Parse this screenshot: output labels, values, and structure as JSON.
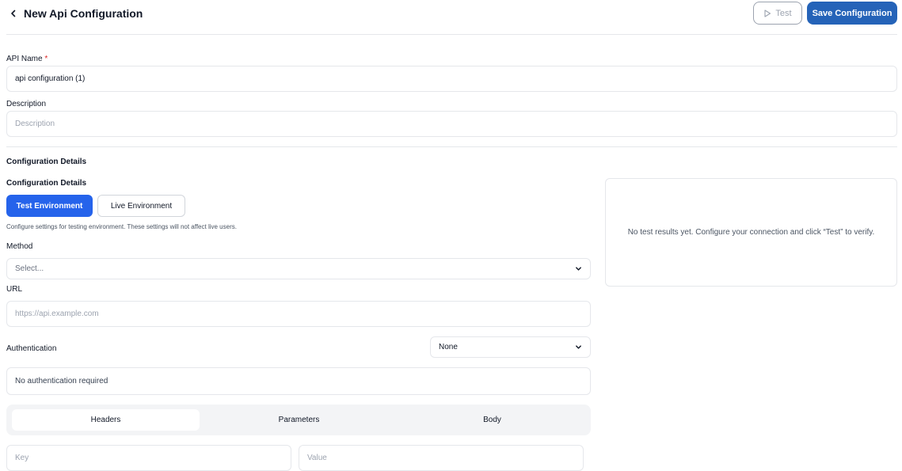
{
  "header": {
    "title": "New Api Configuration",
    "test_label": "Test",
    "save_label": "Save Configuration"
  },
  "form": {
    "api_name": {
      "label": "API Name",
      "required_mark": "*",
      "value": "api configuration (1)"
    },
    "description": {
      "label": "Description",
      "placeholder": "Description",
      "value": ""
    }
  },
  "config": {
    "section_title": "Configuration Details",
    "subsection_title": "Configuration Details",
    "env_tabs": [
      {
        "label": "Test Environment",
        "active": true
      },
      {
        "label": "Live Environment",
        "active": false
      }
    ],
    "hint": "Configure settings for testing environment. These settings will not affect live users.",
    "method": {
      "label": "Method",
      "placeholder": "Select..."
    },
    "url": {
      "label": "URL",
      "placeholder": "https://api.example.com"
    },
    "authentication": {
      "label": "Authentication",
      "selected": "None",
      "info": "No authentication required"
    },
    "request_tabs": [
      {
        "label": "Headers",
        "active": true
      },
      {
        "label": "Parameters",
        "active": false
      },
      {
        "label": "Body",
        "active": false
      }
    ],
    "header_row": {
      "key_placeholder": "Key",
      "value_placeholder": "Value"
    }
  },
  "results": {
    "empty_text": "No test results yet. Configure your connection and click “Test” to verify."
  },
  "colors": {
    "primary": "#2563eb",
    "save_button": "#2563b8",
    "required": "#dc2626",
    "border": "#e5e7eb"
  },
  "icons": {
    "back": "chevron-left-icon",
    "test": "play-icon",
    "dropdown": "chevron-down-icon"
  }
}
